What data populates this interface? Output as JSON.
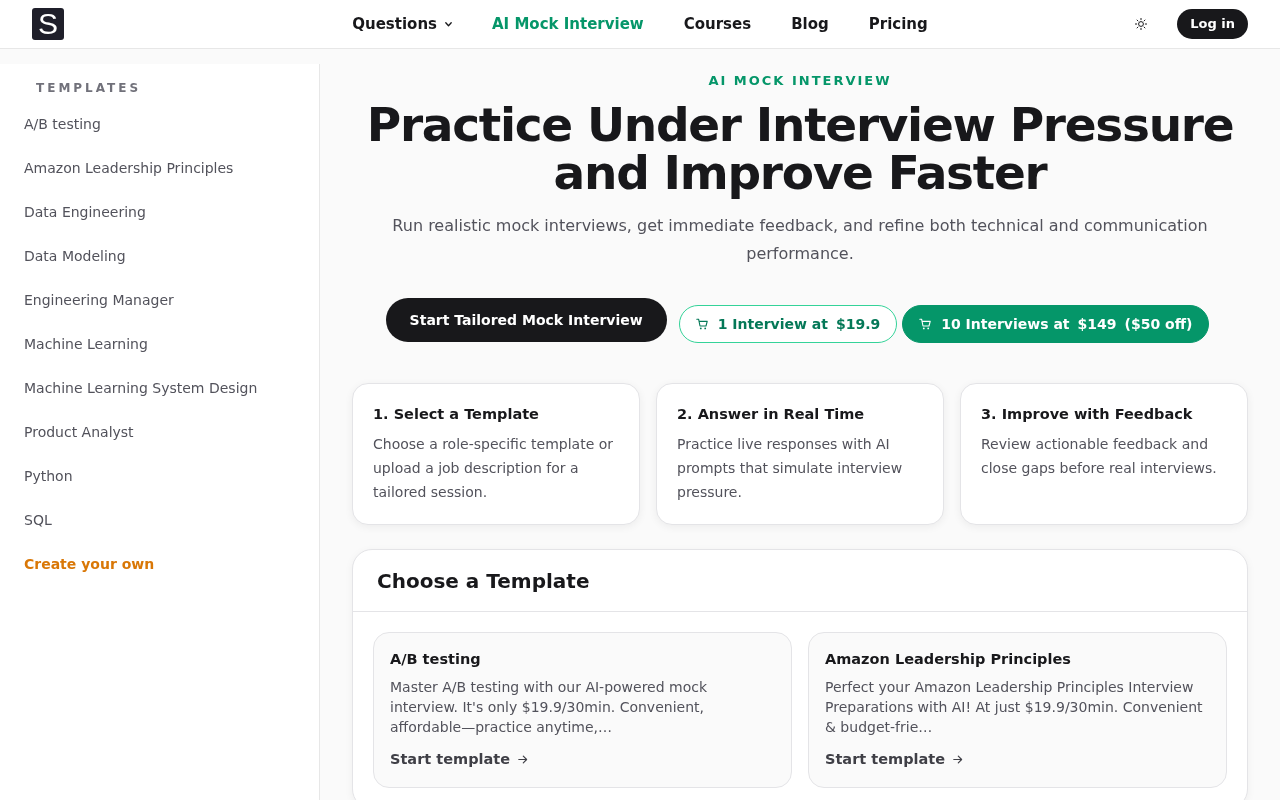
{
  "navbar": {
    "logo": "S",
    "links": [
      {
        "label": "Questions",
        "selected": false,
        "dropdown": true
      },
      {
        "label": "AI Mock Interview",
        "selected": true,
        "dropdown": false
      },
      {
        "label": "Courses",
        "selected": false,
        "dropdown": false
      },
      {
        "label": "Blog",
        "selected": false,
        "dropdown": false
      },
      {
        "label": "Pricing",
        "selected": false,
        "dropdown": false
      }
    ],
    "login": "Log in"
  },
  "sidebar": {
    "heading": "TEMPLATES",
    "items": [
      {
        "label": "A/B testing",
        "kind": "template"
      },
      {
        "label": "Amazon Leadership Principles",
        "kind": "template"
      },
      {
        "label": "Data Engineering",
        "kind": "template"
      },
      {
        "label": "Data Modeling",
        "kind": "template"
      },
      {
        "label": "Engineering Manager",
        "kind": "template"
      },
      {
        "label": "Machine Learning",
        "kind": "template"
      },
      {
        "label": "Machine Learning System Design",
        "kind": "template"
      },
      {
        "label": "Product Analyst",
        "kind": "template"
      },
      {
        "label": "Python",
        "kind": "template"
      },
      {
        "label": "SQL",
        "kind": "template"
      },
      {
        "label": "Create your own",
        "kind": "create"
      }
    ]
  },
  "hero": {
    "eyebrow": "AI MOCK INTERVIEW",
    "title": "Practice Under Interview Pressure and Improve Faster",
    "subtitle": "Run realistic mock interviews, get immediate feedback, and refine both technical and communication performance.",
    "primary_button": "Start Tailored Mock Interview",
    "offers": [
      {
        "kind": "outline",
        "parts": [
          "1 Interview at",
          "$19.9"
        ]
      },
      {
        "kind": "filled",
        "parts": [
          "10 Interviews at",
          "$149",
          "($50 off)"
        ]
      }
    ]
  },
  "steps": [
    {
      "title": "1. Select a Template",
      "text": "Choose a role-specific template or upload a job description for a tailored session."
    },
    {
      "title": "2. Answer in Real Time",
      "text": "Practice live responses with AI prompts that simulate interview pressure."
    },
    {
      "title": "3. Improve with Feedback",
      "text": "Review actionable feedback and close gaps before real interviews."
    }
  ],
  "templates_panel": {
    "title": "Choose a Template",
    "cards": [
      {
        "title": "A/B testing",
        "text": "Master A/B testing with our AI-powered mock interview. It's only $19.9/30min. Convenient, affordable—practice anytime,…",
        "link": "Start template"
      },
      {
        "title": "Amazon Leadership Principles",
        "text": "Perfect your Amazon Leadership Principles Interview Preparations with AI! At just $19.9/30min. Convenient & budget-frie…",
        "link": "Start template"
      }
    ]
  }
}
